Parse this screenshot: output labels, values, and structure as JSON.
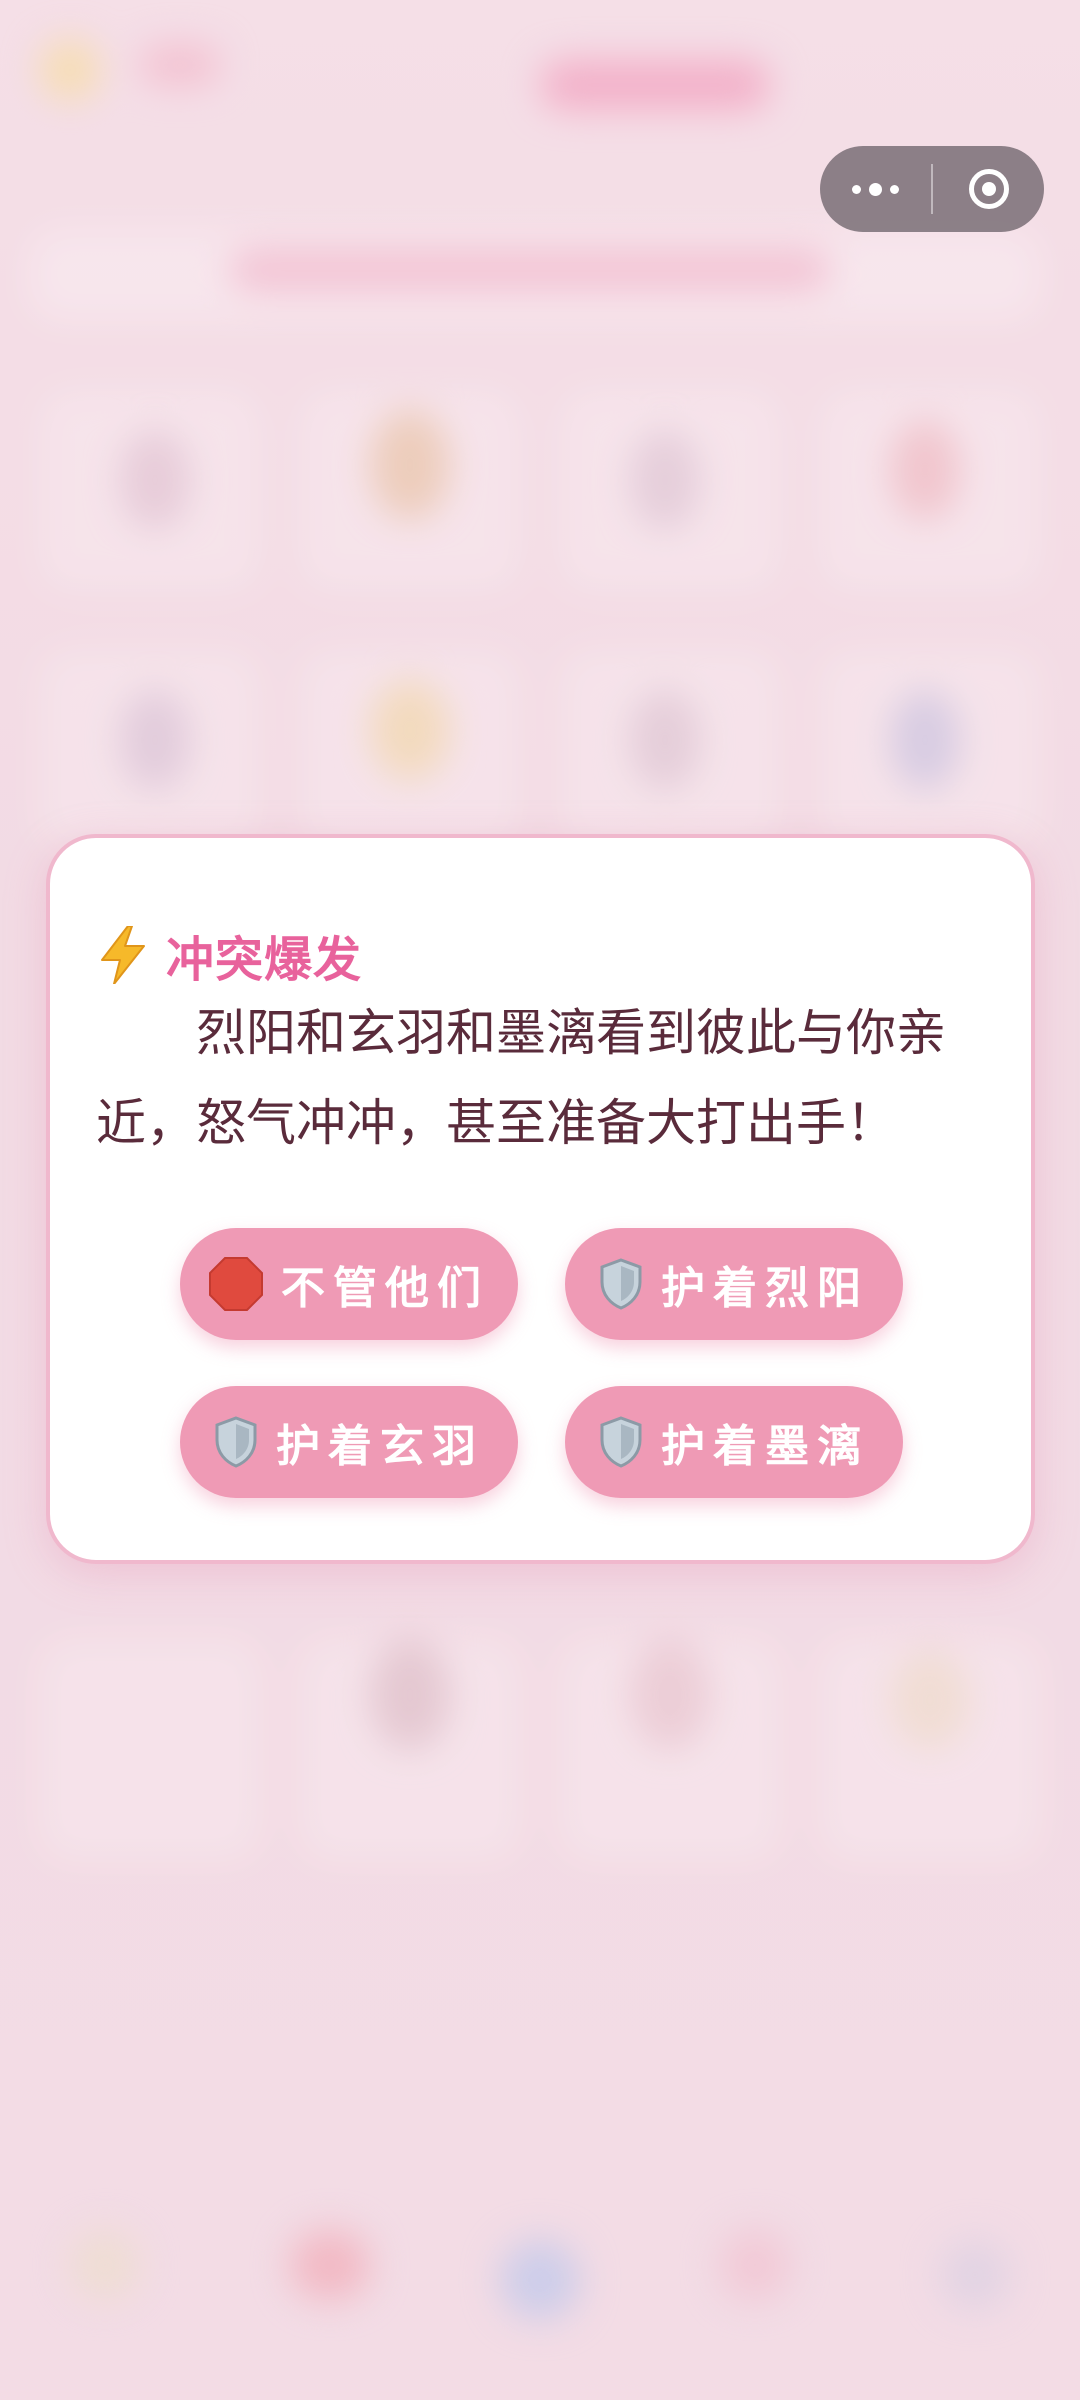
{
  "wechat_capsule": {
    "more_icon": "ellipsis-icon",
    "close_icon": "target-circle-icon"
  },
  "dialog": {
    "title_icon": "lightning-bolt-icon",
    "title": "冲突爆发",
    "message": "烈阳和玄羽和墨漓看到彼此与你亲近，怒气冲冲，甚至准备大打出手！",
    "options": [
      {
        "icon": "stop-sign-icon",
        "label": "不管他们"
      },
      {
        "icon": "shield-icon",
        "label": "护着烈阳"
      },
      {
        "icon": "shield-icon",
        "label": "护着玄羽"
      },
      {
        "icon": "shield-icon",
        "label": "护着墨漓"
      }
    ]
  },
  "colors": {
    "accent_title": "#e8629c",
    "button_bg": "#ef9ab5",
    "body_text": "#5a2b3b",
    "dialog_border": "#f0b8cd",
    "page_bg": "#f3dfe6"
  }
}
